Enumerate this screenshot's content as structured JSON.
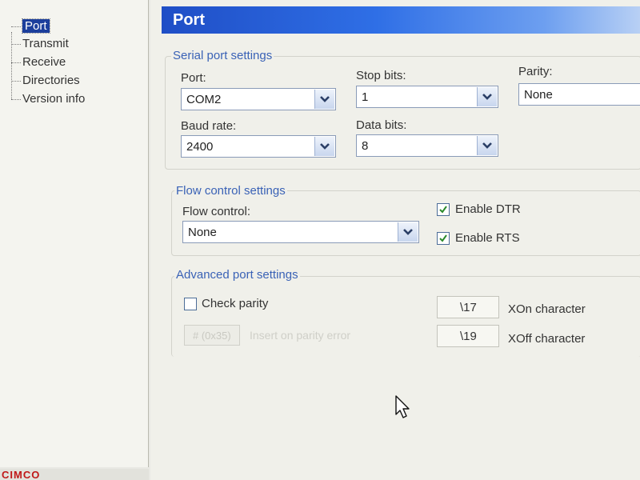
{
  "tree": {
    "items": [
      {
        "label": "Port",
        "selected": true
      },
      {
        "label": "Transmit",
        "selected": false
      },
      {
        "label": "Receive",
        "selected": false
      },
      {
        "label": "Directories",
        "selected": false
      },
      {
        "label": "Version info",
        "selected": false
      }
    ]
  },
  "header": {
    "title": "Port"
  },
  "serial": {
    "group_title": "Serial port settings",
    "port_label": "Port:",
    "port_value": "COM2",
    "stop_bits_label": "Stop bits:",
    "stop_bits_value": "1",
    "parity_label": "Parity:",
    "parity_value": "None",
    "baud_label": "Baud rate:",
    "baud_value": "2400",
    "data_bits_label": "Data bits:",
    "data_bits_value": "8"
  },
  "flow": {
    "group_title": "Flow control settings",
    "flow_label": "Flow control:",
    "flow_value": "None",
    "dtr_label": "Enable DTR",
    "dtr_checked": true,
    "rts_label": "Enable RTS",
    "rts_checked": true
  },
  "advanced": {
    "group_title": "Advanced port settings",
    "check_parity_label": "Check parity",
    "check_parity_checked": false,
    "parity_error_value": "# (0x35)",
    "parity_error_label": "Insert on parity error",
    "xon_value": "\\17",
    "xon_label": "XOn character",
    "xoff_value": "\\19",
    "xoff_label": "XOff character"
  },
  "footer": {
    "logo_text": "CIMCO"
  },
  "colors": {
    "accent": "#1f4ec6",
    "group_title": "#3a62b6",
    "selection": "#1c3f9c"
  }
}
